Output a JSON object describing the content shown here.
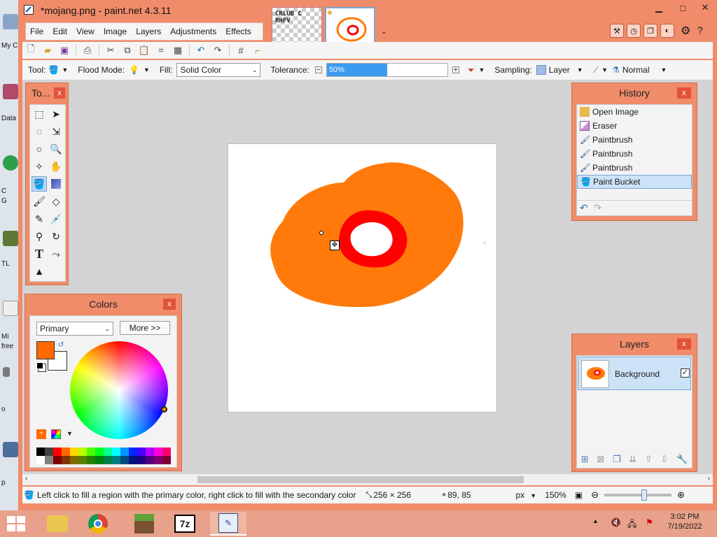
{
  "window": {
    "title": "*mojang.png - paint.net 4.3.11"
  },
  "menu": [
    "File",
    "Edit",
    "View",
    "Image",
    "Layers",
    "Adjustments",
    "Effects"
  ],
  "thumbnails": [
    {
      "name": "thumbnail-1",
      "label": "CRLUB C RHFV"
    },
    {
      "name": "thumbnail-mojang"
    }
  ],
  "options": {
    "tool_label": "Tool:",
    "flood_mode_label": "Flood Mode:",
    "fill_label": "Fill:",
    "fill_value": "Solid Color",
    "tolerance_label": "Tolerance:",
    "tolerance_value": "50%",
    "tolerance_fraction": 0.5,
    "sampling_label": "Sampling:",
    "sampling_value": "Layer",
    "blend_value": "Normal"
  },
  "tools_panel": {
    "title": "To...",
    "close": "x"
  },
  "colors_panel": {
    "title": "Colors",
    "close": "x",
    "mode_value": "Primary",
    "more_button": "More >>",
    "primary_color": "#ff6a00",
    "secondary_color": "#ffffff"
  },
  "history_panel": {
    "title": "History",
    "close": "x",
    "items": [
      "Open Image",
      "Eraser",
      "Paintbrush",
      "Paintbrush",
      "Paintbrush",
      "Paint Bucket"
    ],
    "selected_index": 5
  },
  "layers_panel": {
    "title": "Layers",
    "close": "x",
    "layer_name": "Background"
  },
  "status": {
    "hint": "Left click to fill a region with the primary color, right click to fill with the secondary color",
    "size": "256 × 256",
    "position": "89, 85",
    "unit": "px",
    "zoom": "150%",
    "zoom_fraction": 0.6
  },
  "taskbar": {
    "time": "3:02 PM",
    "date": "7/19/2022"
  },
  "desktop_labels": [
    "My C",
    "Data",
    "C",
    "G",
    "TL",
    "Mi",
    "free",
    "o",
    "p"
  ],
  "colors": {
    "window_frame": "#f08c6a",
    "accent_selected": "#cce3f7",
    "orange": "#ff7a0a",
    "red": "#ff0000"
  }
}
